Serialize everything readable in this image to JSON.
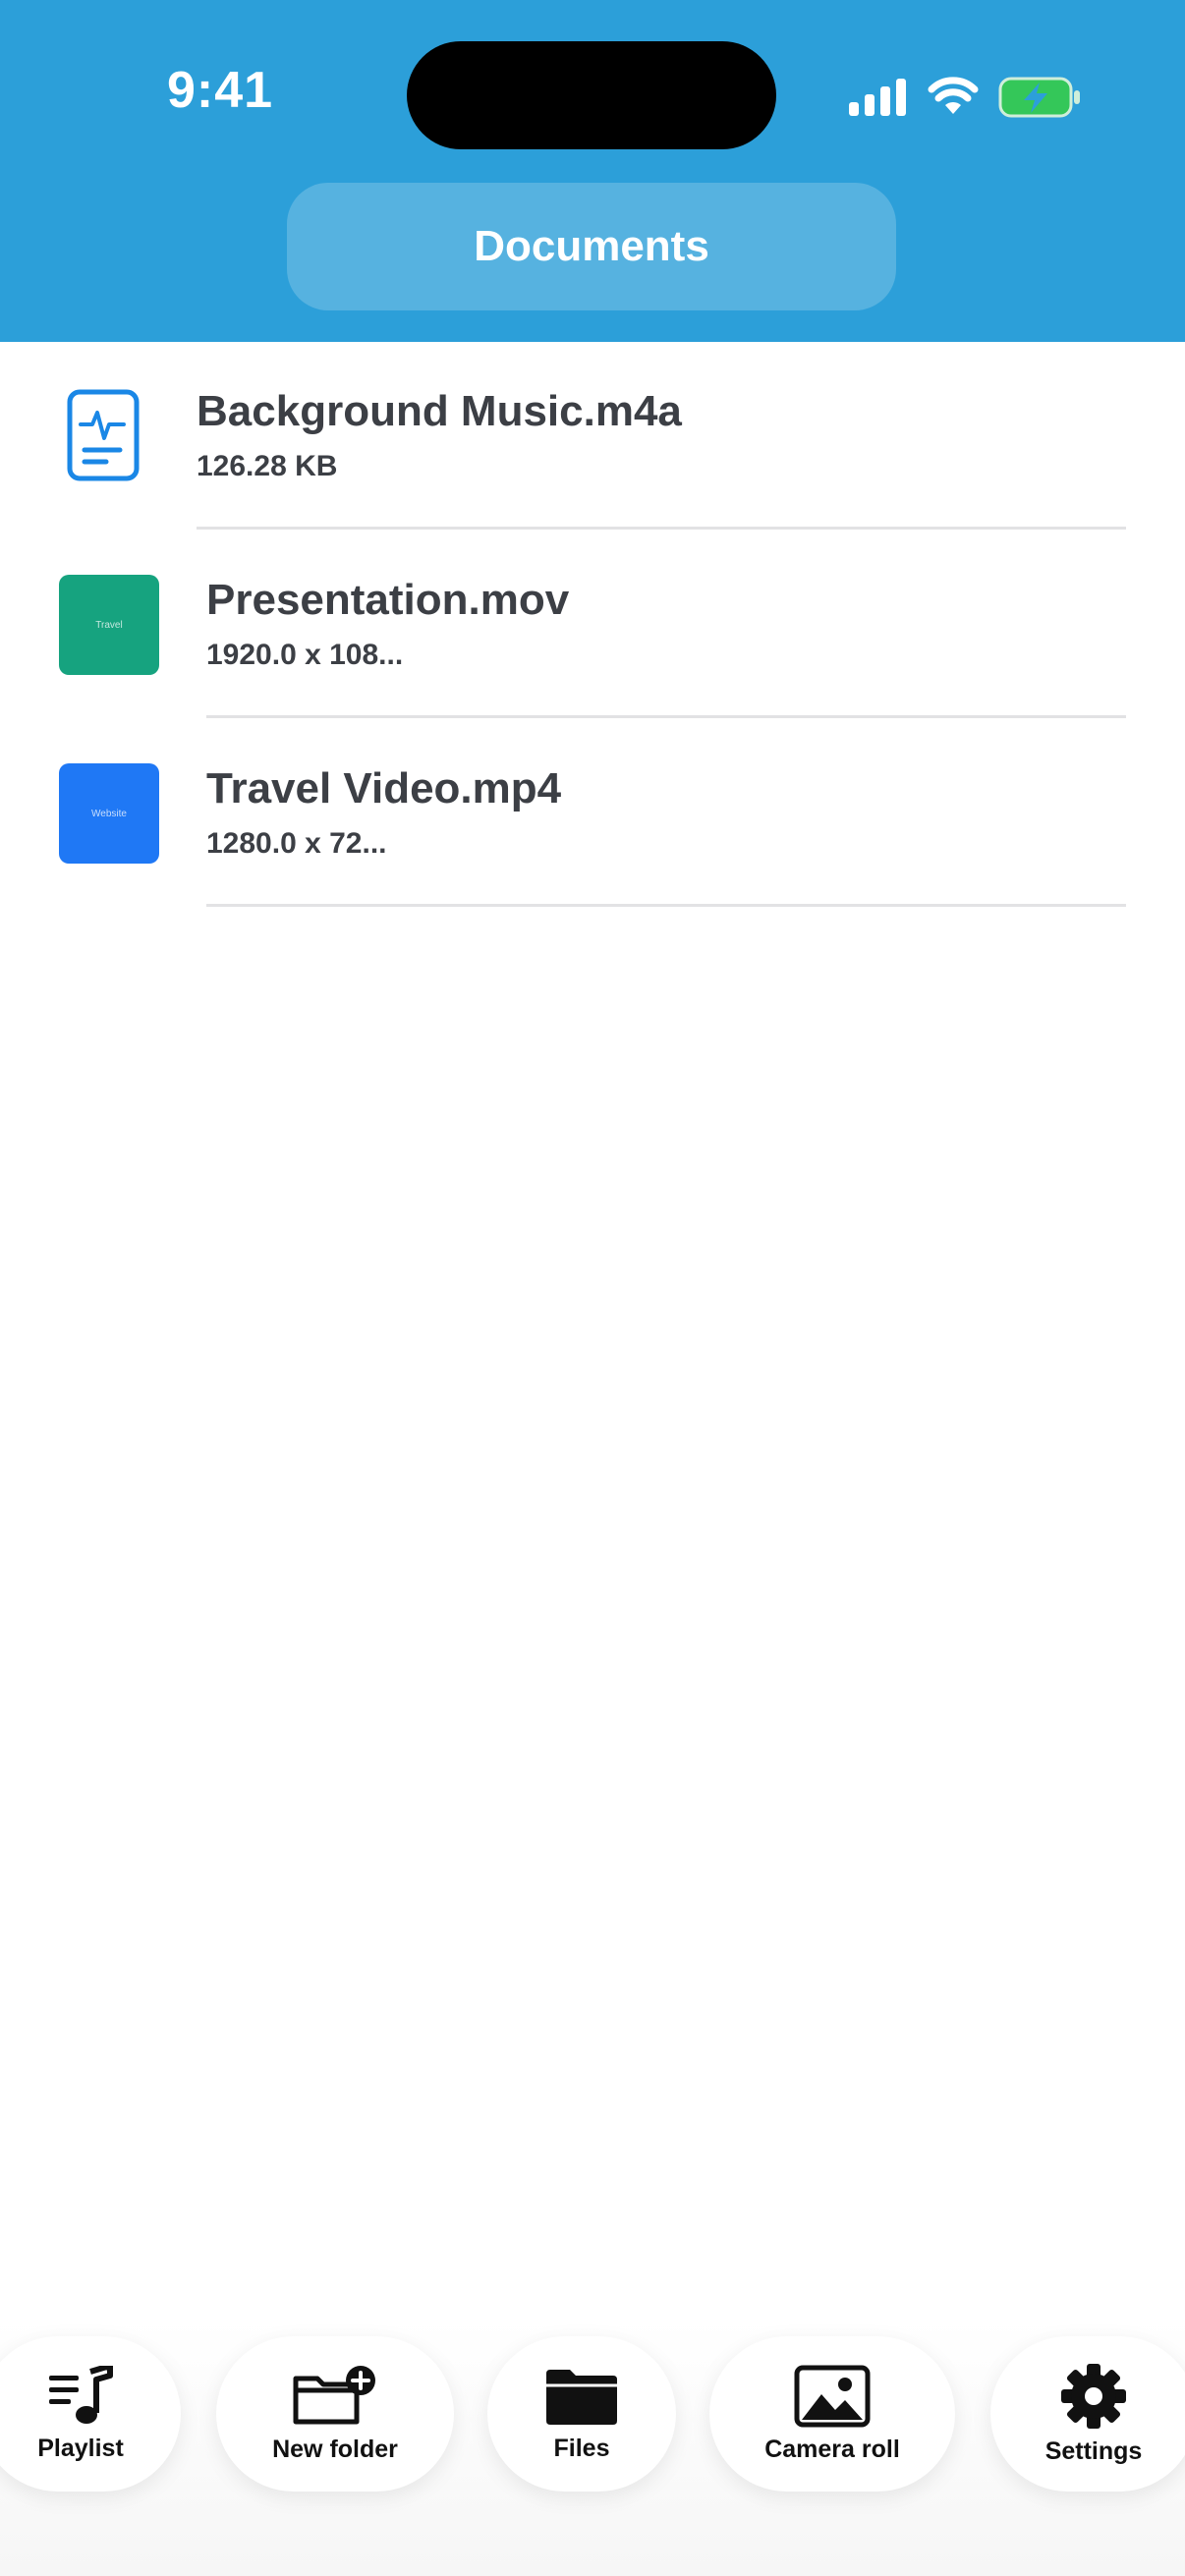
{
  "status_bar": {
    "time": "9:41",
    "icons": [
      "cellular-signal-icon",
      "wifi-icon",
      "battery-charging-icon"
    ]
  },
  "header": {
    "title": "Documents"
  },
  "files": [
    {
      "name": "Background Music.m4a",
      "meta": "126.28 KB",
      "thumb_type": "audio-document-icon"
    },
    {
      "name": "Presentation.mov",
      "meta": "1920.0 x 108...",
      "thumb_type": "video-thumbnail",
      "thumb_label": "Travel",
      "thumb_color": "#16a37f"
    },
    {
      "name": "Travel Video.mp4",
      "meta": "1280.0 x 72...",
      "thumb_type": "video-thumbnail",
      "thumb_label": "Website",
      "thumb_color": "#1f78f5"
    }
  ],
  "tabbar": {
    "items": [
      {
        "label": "Playlist",
        "icon": "playlist-icon"
      },
      {
        "label": "New folder",
        "icon": "new-folder-icon"
      },
      {
        "label": "Files",
        "icon": "folder-icon"
      },
      {
        "label": "Camera roll",
        "icon": "photo-icon"
      },
      {
        "label": "Settings",
        "icon": "gear-icon"
      }
    ]
  },
  "colors": {
    "header_bg": "#2c9fd9",
    "text_primary": "#3c3f45",
    "audio_icon": "#1a87e6",
    "battery_fill": "#34c759"
  }
}
